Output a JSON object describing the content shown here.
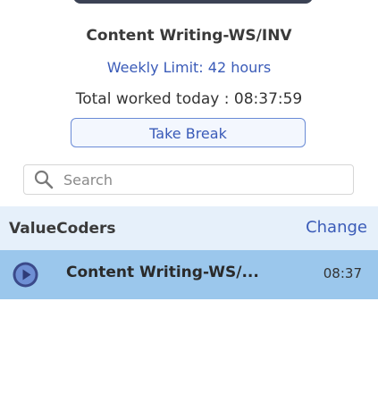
{
  "project": {
    "title": "Content Writing-WS/INV",
    "weekly_limit": "Weekly Limit: 42 hours",
    "total_worked_today": "Total worked today : 08:37:59"
  },
  "actions": {
    "take_break_label": "Take Break"
  },
  "search": {
    "placeholder": "Search",
    "value": ""
  },
  "organization": {
    "name": "ValueCoders",
    "change_label": "Change"
  },
  "tasks": [
    {
      "name": "Content Writing-WS/...",
      "time": "08:37",
      "icon": "play-circle-icon"
    }
  ],
  "colors": {
    "accent": "#3a5bb8",
    "org_row_bg": "#e6f0fa",
    "selected_row_bg": "#9bc7ec",
    "play_icon": "#3b4a8a"
  }
}
